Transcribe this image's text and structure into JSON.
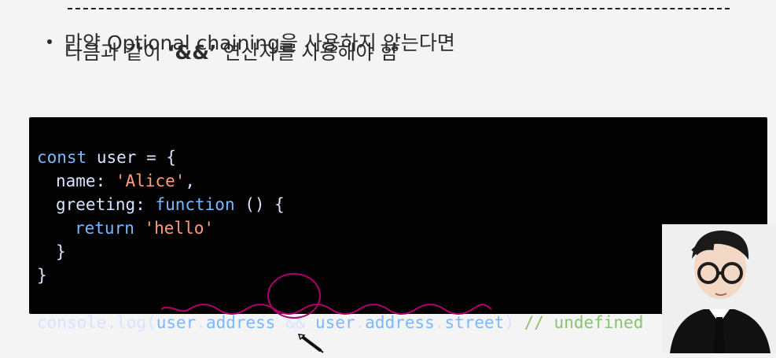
{
  "slide": {
    "bullet": {
      "line1": "만약 Optional chaining을 사용하지 않는다면",
      "line2_prefix": "다음과 같이 ",
      "line2_bold": "‘&&’",
      "line2_suffix": " 연산자를 사용해야 함"
    },
    "code": {
      "line1_kw": "const",
      "line1_rest": " user = {",
      "line2_key": "name",
      "line2_sep": ": ",
      "line2_val": "'Alice'",
      "line2_end": ",",
      "line3_key": "greeting",
      "line3_sep": ": ",
      "line3_kw": "function",
      "line3_rest": " () {",
      "line4_kw": "return",
      "line4_str": "'hello'",
      "line5": "}",
      "line6": "}",
      "line8_start": "console.log(",
      "line8_a": "user",
      "line8_b": ".",
      "line8_c": "address",
      "line8_d": " && ",
      "line8_e": "user",
      "line8_f": ".",
      "line8_g": "address",
      "line8_h": ".",
      "line8_i": "street",
      "line8_j": ")",
      "line8_comment": "// undefined"
    }
  },
  "colors": {
    "background": "#f4f4f4",
    "code_background": "#020202",
    "keyword": "#7ab8ff",
    "string": "#ff9c7a",
    "comment": "#8ac36f",
    "annotation": "#b1006b"
  },
  "icons": {
    "pencil": "pencil-icon",
    "presenter": "presenter-avatar-icon"
  }
}
